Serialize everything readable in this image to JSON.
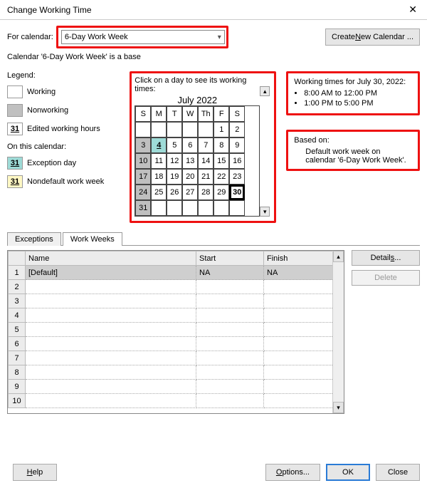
{
  "window": {
    "title": "Change Working Time",
    "close": "✕"
  },
  "topbar": {
    "for_calendar_label": "For calendar:",
    "selected_calendar": "6-Day Work Week",
    "create_new_prefix": "Create ",
    "create_new_underlined": "N",
    "create_new_suffix": "ew Calendar ...",
    "base_line": "Calendar '6-Day Work Week' is a base"
  },
  "legend": {
    "title": "Legend:",
    "working": "Working",
    "nonworking": "Nonworking",
    "edited": "Edited working hours",
    "subtitle": "On this calendar:",
    "exception": "Exception day",
    "nondefault": "Nondefault work week",
    "swatch31": "31"
  },
  "calendar": {
    "instruction": "Click on a day to see its working times:",
    "month": "July 2022",
    "dow": [
      "S",
      "M",
      "T",
      "W",
      "Th",
      "F",
      "S"
    ],
    "weeks": [
      [
        {
          "d": ""
        },
        {
          "d": ""
        },
        {
          "d": ""
        },
        {
          "d": ""
        },
        {
          "d": ""
        },
        {
          "d": "1"
        },
        {
          "d": "2"
        }
      ],
      [
        {
          "d": "3",
          "nw": true
        },
        {
          "d": "4",
          "hol": true
        },
        {
          "d": "5"
        },
        {
          "d": "6"
        },
        {
          "d": "7"
        },
        {
          "d": "8"
        },
        {
          "d": "9"
        }
      ],
      [
        {
          "d": "10",
          "nw": true
        },
        {
          "d": "11"
        },
        {
          "d": "12"
        },
        {
          "d": "13"
        },
        {
          "d": "14"
        },
        {
          "d": "15"
        },
        {
          "d": "16"
        }
      ],
      [
        {
          "d": "17",
          "nw": true
        },
        {
          "d": "18"
        },
        {
          "d": "19"
        },
        {
          "d": "20"
        },
        {
          "d": "21"
        },
        {
          "d": "22"
        },
        {
          "d": "23"
        }
      ],
      [
        {
          "d": "24",
          "nw": true
        },
        {
          "d": "25"
        },
        {
          "d": "26"
        },
        {
          "d": "27"
        },
        {
          "d": "28"
        },
        {
          "d": "29"
        },
        {
          "d": "30",
          "sel": true
        }
      ],
      [
        {
          "d": "31",
          "nw": true
        },
        {
          "d": ""
        },
        {
          "d": ""
        },
        {
          "d": ""
        },
        {
          "d": ""
        },
        {
          "d": ""
        },
        {
          "d": ""
        }
      ]
    ]
  },
  "working_times": {
    "heading": "Working times for July 30, 2022:",
    "slots": [
      "8:00 AM to 12:00 PM",
      "1:00 PM to 5:00 PM"
    ]
  },
  "based_on": {
    "heading": "Based on:",
    "text": "Default work week on calendar '6-Day Work Week'."
  },
  "tabs": {
    "exceptions": "Exceptions",
    "workweeks": "Work Weeks"
  },
  "table": {
    "headers": {
      "name": "Name",
      "start": "Start",
      "finish": "Finish"
    },
    "rows": [
      {
        "num": "1",
        "name": "[Default]",
        "start": "NA",
        "finish": "NA",
        "selected": true
      },
      {
        "num": "2",
        "name": "",
        "start": "",
        "finish": ""
      },
      {
        "num": "3",
        "name": "",
        "start": "",
        "finish": ""
      },
      {
        "num": "4",
        "name": "",
        "start": "",
        "finish": ""
      },
      {
        "num": "5",
        "name": "",
        "start": "",
        "finish": ""
      },
      {
        "num": "6",
        "name": "",
        "start": "",
        "finish": ""
      },
      {
        "num": "7",
        "name": "",
        "start": "",
        "finish": ""
      },
      {
        "num": "8",
        "name": "",
        "start": "",
        "finish": ""
      },
      {
        "num": "9",
        "name": "",
        "start": "",
        "finish": ""
      },
      {
        "num": "10",
        "name": "",
        "start": "",
        "finish": ""
      }
    ]
  },
  "side_buttons": {
    "details_prefix": "Detail",
    "details_underlined": "s",
    "details_suffix": "...",
    "delete": "Delete"
  },
  "footer": {
    "help_underlined": "H",
    "help_suffix": "elp",
    "options_underlined": "O",
    "options_suffix": "ptions...",
    "ok": "OK",
    "close": "Close"
  }
}
